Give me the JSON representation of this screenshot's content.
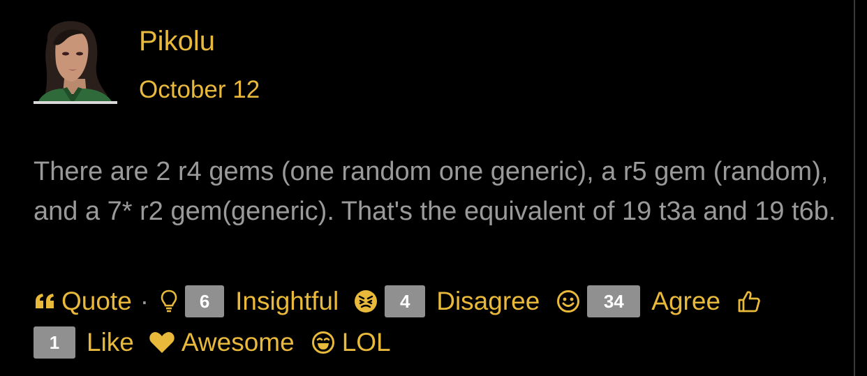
{
  "post": {
    "author": "Pikolu",
    "date": "October 12",
    "body": "There are 2 r4 gems (one random one generic), a r5 gem (random), and a 7* r2 gem(generic). That's the equivalent of 19 t3a and 19 t6b."
  },
  "actions": {
    "quote_label": "Quote",
    "separator": "·"
  },
  "reactions": {
    "insightful": {
      "count": "6",
      "label": "Insightful",
      "icon": "lightbulb-icon"
    },
    "disagree": {
      "count": "4",
      "label": "Disagree",
      "icon": "angry-face-icon"
    },
    "agree": {
      "count": "34",
      "label": "Agree",
      "icon": "smile-face-icon"
    },
    "like": {
      "count": "1",
      "label": "Like",
      "icon": "thumbs-up-icon"
    },
    "awesome": {
      "label": "Awesome",
      "icon": "heart-icon"
    },
    "lol": {
      "label": "LOL",
      "icon": "laughing-face-icon"
    }
  },
  "colors": {
    "background": "#000000",
    "accent": "#e8b93b",
    "body_text": "#9a9a9a",
    "count_badge": "#909090"
  }
}
